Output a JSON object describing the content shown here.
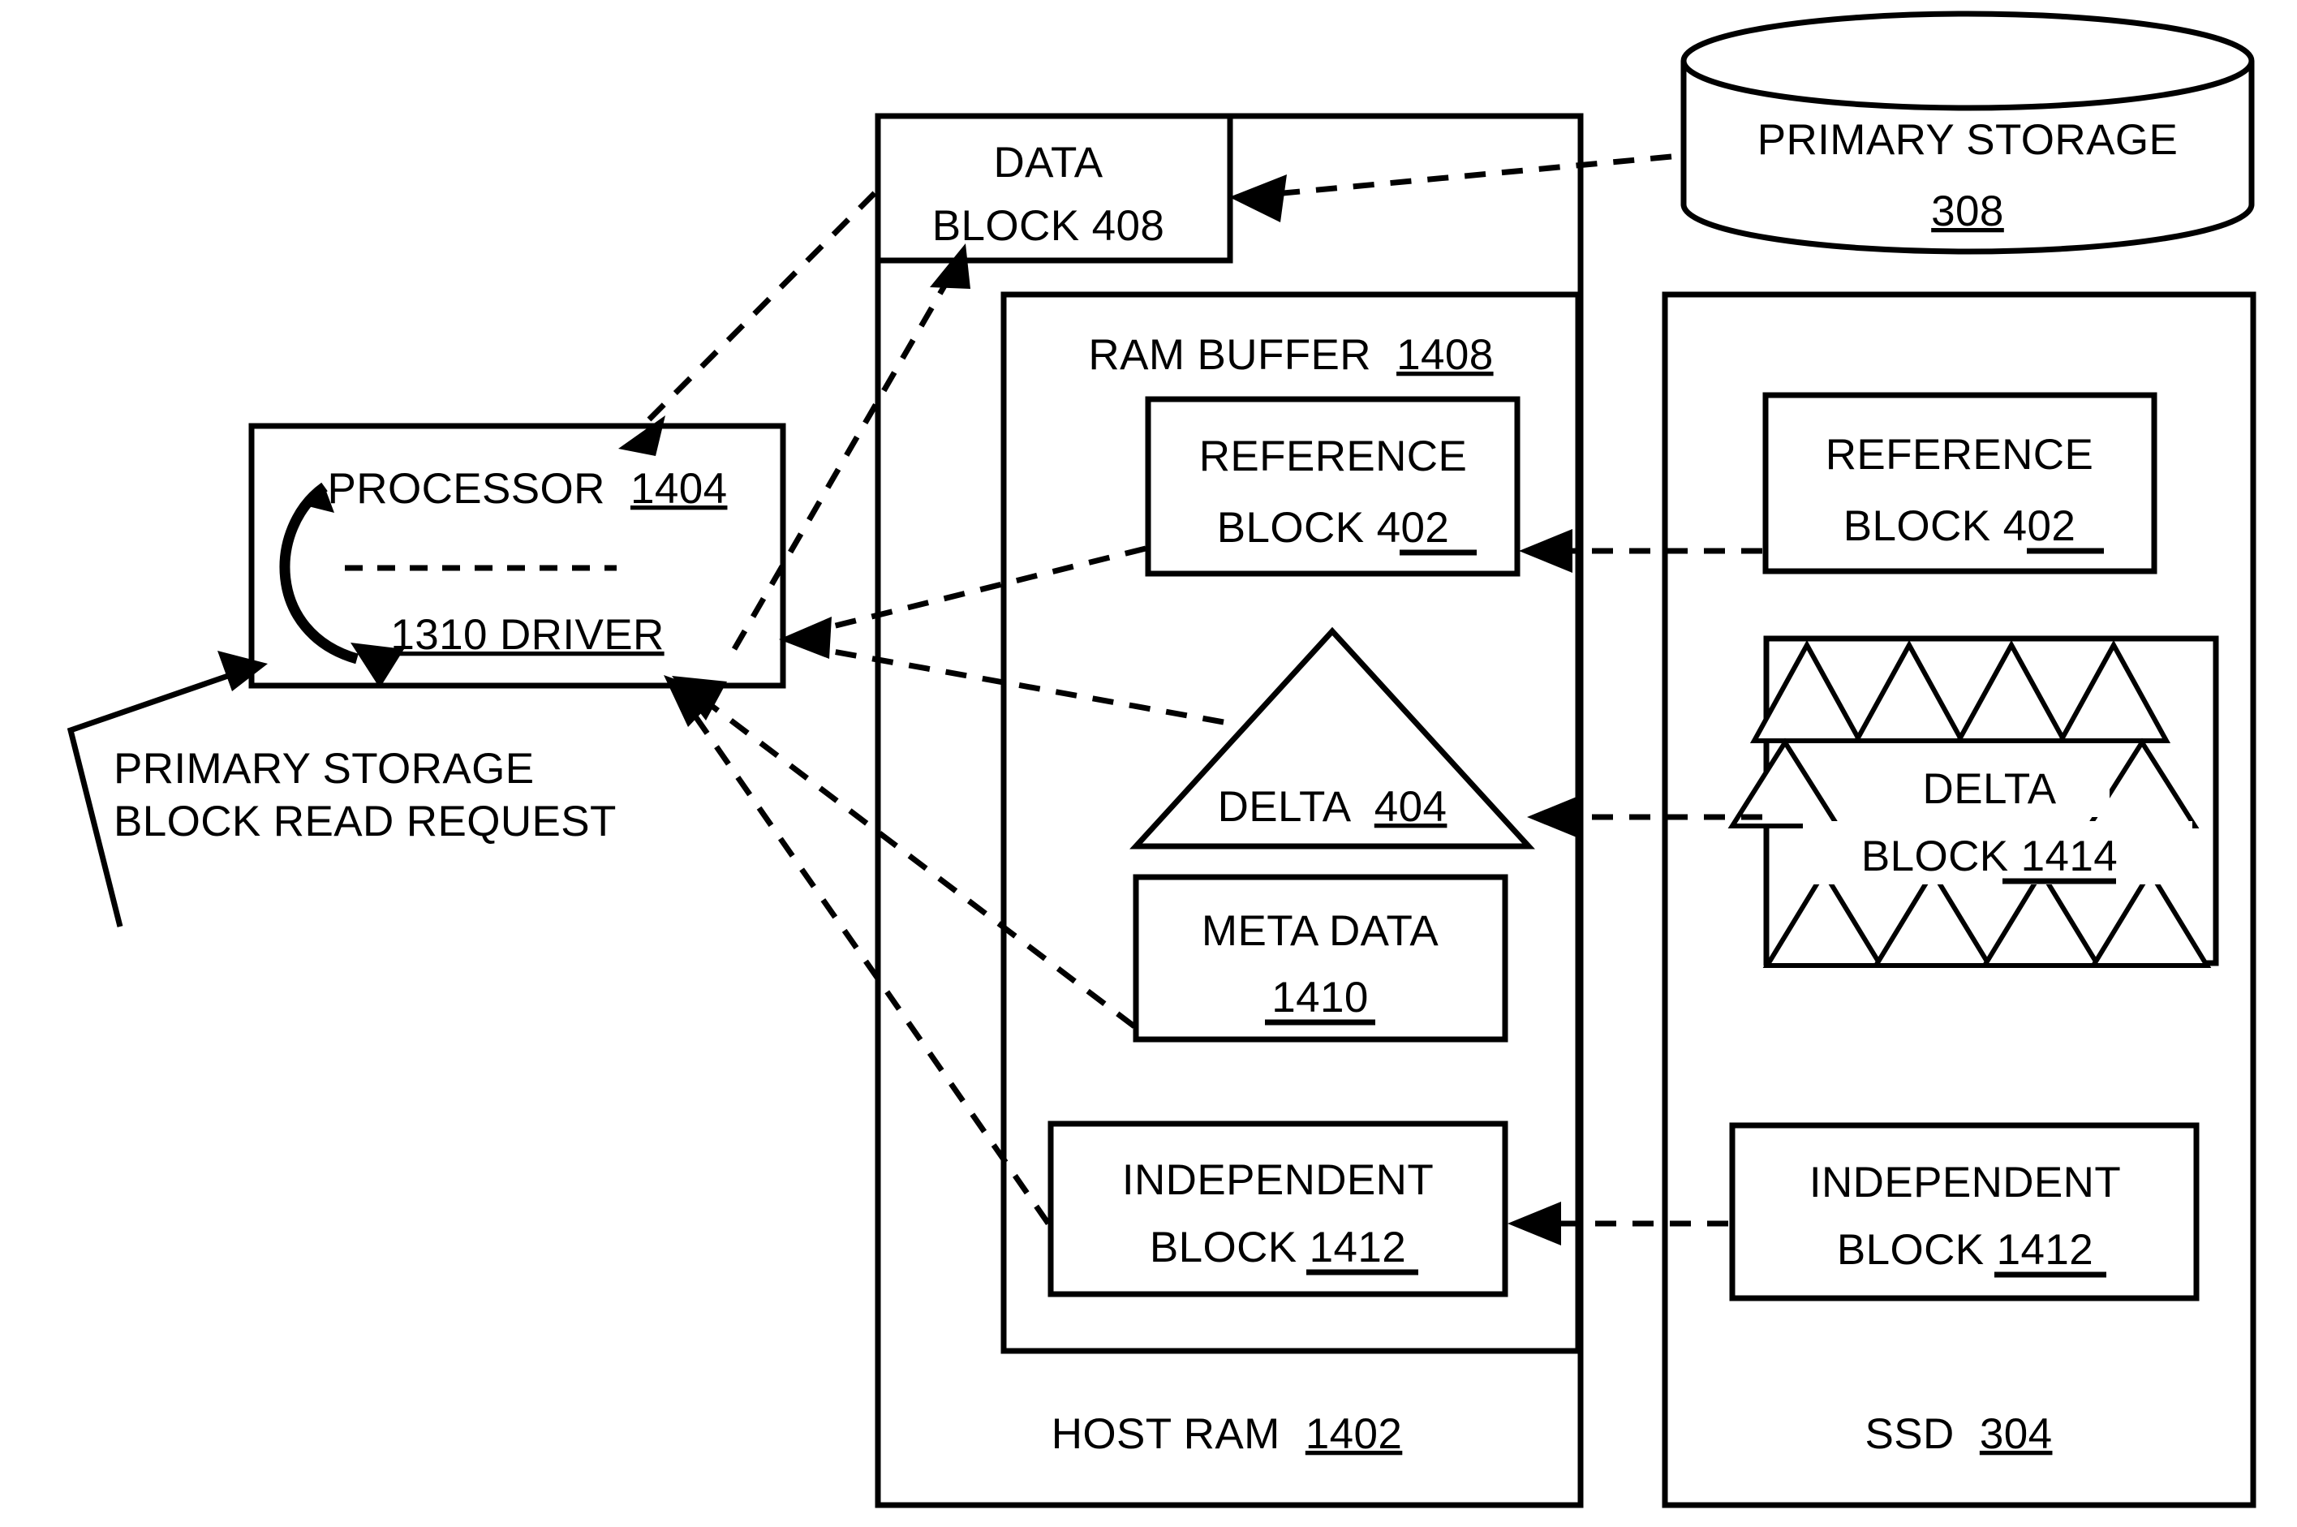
{
  "figure": {
    "type": "patent-block-diagram",
    "background": "#ffffff",
    "line_color": "#000000"
  },
  "nodes": {
    "processor": {
      "title": "PROCESSOR 1404",
      "title_text": "PROCESSOR",
      "title_ref": "1404",
      "driver_text": "1310 DRIVER",
      "driver_ref_prefix": "1310",
      "driver_name": "DRIVER"
    },
    "primary_storage": {
      "line1": "PRIMARY STORAGE",
      "ref": "308"
    },
    "data_block": {
      "line1": "DATA",
      "line2": "BLOCK 408",
      "ref": "408"
    },
    "host_ram": {
      "label": "HOST RAM",
      "ref": "1402"
    },
    "ram_buffer": {
      "label": "RAM BUFFER",
      "ref": "1408"
    },
    "ram_reference_block": {
      "line1": "REFERENCE",
      "line2": "BLOCK 402",
      "ref": "402"
    },
    "ram_delta": {
      "label": "DELTA",
      "ref": "404"
    },
    "ram_meta_data": {
      "line1": "META DATA",
      "line2": "1410",
      "ref": "1410"
    },
    "ram_independent_block": {
      "line1": "INDEPENDENT",
      "line2": "BLOCK 1412",
      "ref": "1412"
    },
    "ssd": {
      "label": "SSD",
      "ref": "304"
    },
    "ssd_reference_block": {
      "line1": "REFERENCE",
      "line2": "BLOCK 402",
      "ref": "402"
    },
    "ssd_delta_block": {
      "line1": "DELTA",
      "line2": "BLOCK 1414",
      "ref": "1414",
      "triangle_rows": [
        4,
        2,
        4
      ]
    },
    "ssd_independent_block": {
      "line1": "INDEPENDENT",
      "line2": "BLOCK 1412",
      "ref": "1412"
    }
  },
  "annotations": {
    "read_request": {
      "line1": "PRIMARY STORAGE",
      "line2": "BLOCK READ REQUEST"
    }
  },
  "connections": [
    {
      "name": "primary-storage-to-data-block",
      "style": "dashed",
      "from": "primary_storage",
      "to": "data_block"
    },
    {
      "name": "host-ram-to-processor",
      "style": "dashed",
      "from": "host_ram",
      "to": "processor"
    },
    {
      "name": "driver-to-data-block",
      "style": "dashed",
      "from": "driver",
      "to": "data_block"
    },
    {
      "name": "ram-reference-block-to-driver",
      "style": "dashed",
      "from": "ram_reference_block",
      "to": "driver"
    },
    {
      "name": "ram-delta-to-driver",
      "style": "dashed",
      "from": "ram_delta",
      "to": "driver"
    },
    {
      "name": "ram-meta-data-to-driver",
      "style": "dashed",
      "from": "ram_meta_data",
      "to": "driver"
    },
    {
      "name": "ram-independent-block-to-driver",
      "style": "dashed",
      "from": "ram_independent_block",
      "to": "driver"
    },
    {
      "name": "ssd-reference-block-to-ram-reference-block",
      "style": "dashed",
      "from": "ssd_reference_block",
      "to": "ram_reference_block"
    },
    {
      "name": "ssd-delta-block-to-ram-delta",
      "style": "dashed",
      "from": "ssd_delta_block",
      "to": "ram_delta"
    },
    {
      "name": "ssd-independent-block-to-ram-independent-block",
      "style": "dashed",
      "from": "ssd_independent_block",
      "to": "ram_independent_block"
    },
    {
      "name": "read-request-to-processor",
      "style": "solid",
      "from": "read_request",
      "to": "processor"
    }
  ]
}
